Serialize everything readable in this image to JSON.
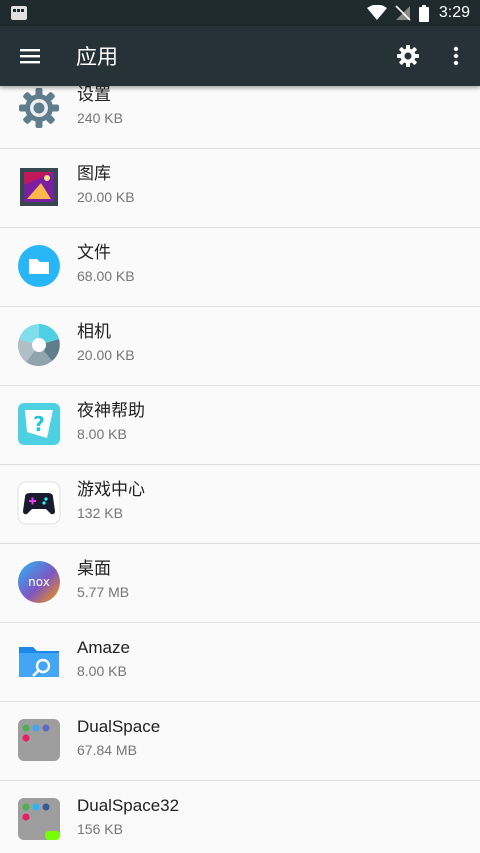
{
  "status_bar": {
    "time": "3:29"
  },
  "app_bar": {
    "title": "应用"
  },
  "apps": [
    {
      "name": "设置",
      "size": "240 KB",
      "icon": "settings-gear-icon"
    },
    {
      "name": "图库",
      "size": "20.00 KB",
      "icon": "gallery-icon"
    },
    {
      "name": "文件",
      "size": "68.00 KB",
      "icon": "files-folder-icon"
    },
    {
      "name": "相机",
      "size": "20.00 KB",
      "icon": "camera-aperture-icon"
    },
    {
      "name": "夜神帮助",
      "size": "8.00 KB",
      "icon": "help-question-icon"
    },
    {
      "name": "游戏中心",
      "size": "132 KB",
      "icon": "gamepad-icon"
    },
    {
      "name": "桌面",
      "size": "5.77 MB",
      "icon": "nox-launcher-icon"
    },
    {
      "name": "Amaze",
      "size": "8.00 KB",
      "icon": "amaze-folder-search-icon"
    },
    {
      "name": "DualSpace",
      "size": "67.84 MB",
      "icon": "dualspace-icon"
    },
    {
      "name": "DualSpace32",
      "size": "156 KB",
      "icon": "dualspace32-icon"
    }
  ],
  "colors": {
    "status_bar": "#1f2a2d",
    "app_bar": "#263238",
    "background": "#fafafa"
  }
}
